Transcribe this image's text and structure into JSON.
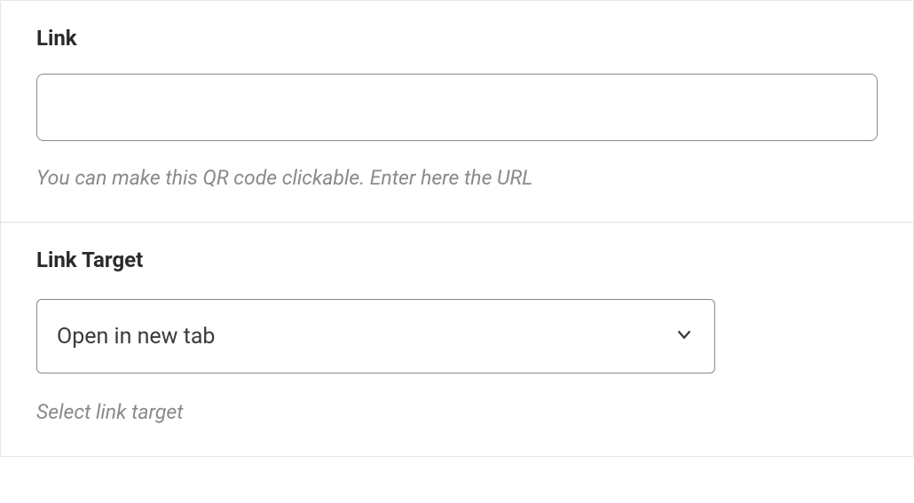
{
  "link": {
    "label": "Link",
    "value": "",
    "help": "You can make this QR code clickable. Enter here the URL"
  },
  "linkTarget": {
    "label": "Link Target",
    "selected": "Open in new tab",
    "help": "Select link target"
  }
}
